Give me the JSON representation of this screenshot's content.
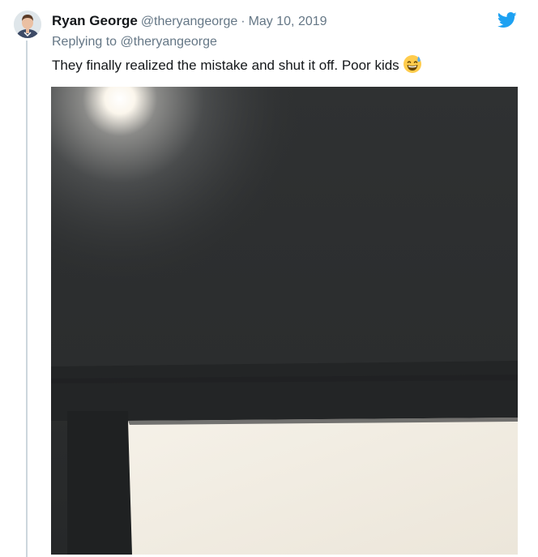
{
  "tweet": {
    "author": {
      "display_name": "Ryan George",
      "handle": "@theryangeorge",
      "avatar_icon": "avatar-photo"
    },
    "separator": "·",
    "date": "May 10, 2019",
    "replying_prefix": "Replying to",
    "replying_to": "@theryangeorge",
    "text": "They finally realized the mistake and shut it off. Poor kids",
    "emoji": "grinning-face-with-sweat",
    "platform_icon": "twitter-bird-icon",
    "media": {
      "kind": "photo",
      "subject": "dark ceiling with bright light"
    }
  },
  "colors": {
    "twitter_blue": "#1da1f2",
    "secondary_text": "#657786",
    "primary_text": "#14171a",
    "thread_line": "#ccd6dd"
  }
}
